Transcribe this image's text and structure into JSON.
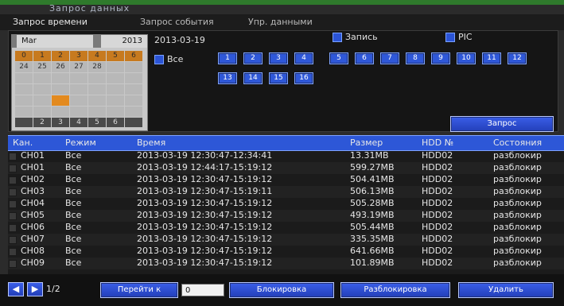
{
  "title": "Запрос данных",
  "tabs": [
    "Запрос времени",
    "Запрос события",
    "Упр. данными"
  ],
  "calendar": {
    "month": "Mar",
    "year": "2013",
    "week_header": [
      "0",
      "1",
      "2",
      "3",
      "4",
      "5",
      "6"
    ],
    "first_row": [
      "24",
      "25",
      "26",
      "27",
      "28"
    ],
    "footer_days": [
      "",
      "2",
      "3",
      "4",
      "5",
      "6"
    ]
  },
  "selected_date": "2013-03-19",
  "options": {
    "record": "Запись",
    "pic": "PIC"
  },
  "all_label": "Все",
  "channels": [
    "1",
    "2",
    "3",
    "4",
    "5",
    "6",
    "7",
    "8",
    "9",
    "10",
    "11",
    "12",
    "13",
    "14",
    "15",
    "16"
  ],
  "buttons": {
    "query": "Запрос",
    "goto": "Перейти к",
    "lock": "Блокировка",
    "unlock": "Разблокировка",
    "delete": "Удалить"
  },
  "table": {
    "headers": [
      "Кан.",
      "Режим",
      "Время",
      "Размер",
      "HDD №",
      "Состояния"
    ],
    "rows": [
      [
        "CH01",
        "Все",
        "2013-03-19 12:30:47-12:34:41",
        "13.31MB",
        "HDD02",
        "разблокир"
      ],
      [
        "CH01",
        "Все",
        "2013-03-19 12:44:17-15:19:12",
        "599.27MB",
        "HDD02",
        "разблокир"
      ],
      [
        "CH02",
        "Все",
        "2013-03-19 12:30:47-15:19:12",
        "504.41MB",
        "HDD02",
        "разблокир"
      ],
      [
        "CH03",
        "Все",
        "2013-03-19 12:30:47-15:19:11",
        "506.13MB",
        "HDD02",
        "разблокир"
      ],
      [
        "CH04",
        "Все",
        "2013-03-19 12:30:47-15:19:12",
        "505.28MB",
        "HDD02",
        "разблокир"
      ],
      [
        "CH05",
        "Все",
        "2013-03-19 12:30:47-15:19:12",
        "493.19MB",
        "HDD02",
        "разблокир"
      ],
      [
        "CH06",
        "Все",
        "2013-03-19 12:30:47-15:19:12",
        "505.44MB",
        "HDD02",
        "разблокир"
      ],
      [
        "CH07",
        "Все",
        "2013-03-19 12:30:47-15:19:12",
        "335.35MB",
        "HDD02",
        "разблокир"
      ],
      [
        "CH08",
        "Все",
        "2013-03-19 12:30:47-15:19:12",
        "641.66MB",
        "HDD02",
        "разблокир"
      ],
      [
        "CH09",
        "Все",
        "2013-03-19 12:30:47-15:19:12",
        "101.89MB",
        "HDD02",
        "разблокир"
      ]
    ]
  },
  "pagination": {
    "page": "1/2",
    "goto_value": "0"
  },
  "colors": {
    "accent": "#2d57d7",
    "highlight": "#e38a1f"
  }
}
